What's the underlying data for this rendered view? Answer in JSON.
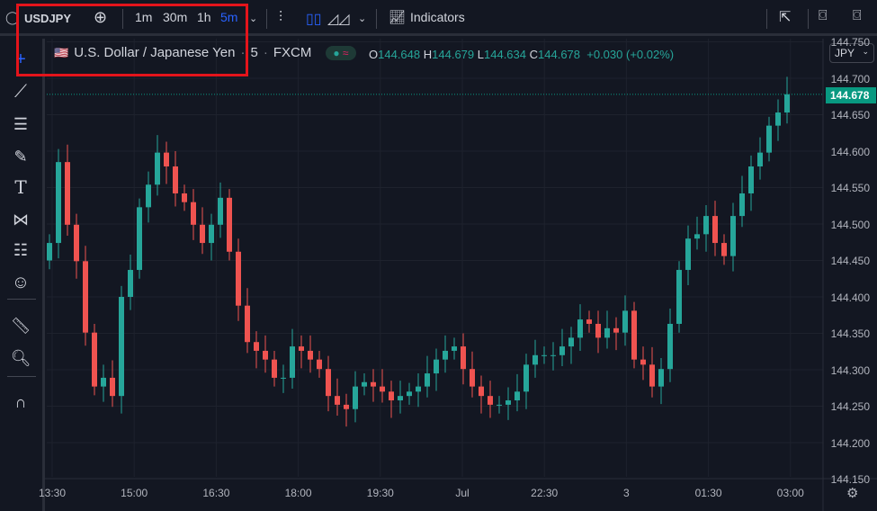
{
  "topbar": {
    "symbol": "USDJPY",
    "intervals": [
      "1m",
      "30m",
      "1h",
      "5m"
    ],
    "active_interval": "5m",
    "indicators_label": "Indicators"
  },
  "legend": {
    "title": "U.S. Dollar / Japanese Yen",
    "interval": "5",
    "exchange": "FXCM",
    "o_label": "O",
    "o": "144.648",
    "h_label": "H",
    "h": "144.679",
    "l_label": "L",
    "l": "144.634",
    "c_label": "C",
    "c": "144.678",
    "change": "+0.030 (+0.02%)"
  },
  "price_axis": {
    "currency": "JPY",
    "labels": [
      "144.750",
      "144.700",
      "144.650",
      "144.600",
      "144.550",
      "144.500",
      "144.450",
      "144.400",
      "144.350",
      "144.300",
      "144.250",
      "144.200",
      "144.150"
    ],
    "last_price": "144.678"
  },
  "time_axis": {
    "labels": [
      "13:30",
      "15:00",
      "16:30",
      "18:00",
      "19:30",
      "Jul",
      "22:30",
      "3",
      "01:30",
      "03:00"
    ]
  },
  "colors": {
    "up": "#26a69a",
    "down": "#ef5350",
    "accent": "#2962ff",
    "bg": "#131722"
  },
  "chart_data": {
    "type": "candlestick",
    "first_open": 144.45,
    "ylim": [
      144.15,
      144.75
    ],
    "close": [
      144.474,
      144.585,
      144.499,
      144.449,
      144.351,
      144.277,
      144.289,
      144.264,
      144.4,
      144.437,
      144.523,
      144.554,
      144.598,
      144.579,
      144.542,
      144.53,
      144.499,
      144.474,
      144.499,
      144.536,
      144.462,
      144.388,
      144.338,
      144.326,
      144.314,
      144.289,
      144.289,
      144.332,
      144.326,
      144.314,
      144.301,
      144.264,
      144.252,
      144.246,
      144.277,
      144.283,
      144.277,
      144.27,
      144.258,
      144.264,
      144.27,
      144.277,
      144.295,
      144.314,
      144.326,
      144.332,
      144.301,
      144.277,
      144.264,
      144.252,
      144.252,
      144.258,
      144.27,
      144.307,
      144.32,
      144.32,
      144.32,
      144.332,
      144.344,
      144.369,
      144.363,
      144.344,
      144.357,
      144.351,
      144.381,
      144.314,
      144.307,
      144.277,
      144.301,
      144.363,
      144.437,
      144.48,
      144.486,
      144.511,
      144.474,
      144.456,
      144.511,
      144.542,
      144.579,
      144.598,
      144.635,
      144.653,
      144.678
    ]
  }
}
